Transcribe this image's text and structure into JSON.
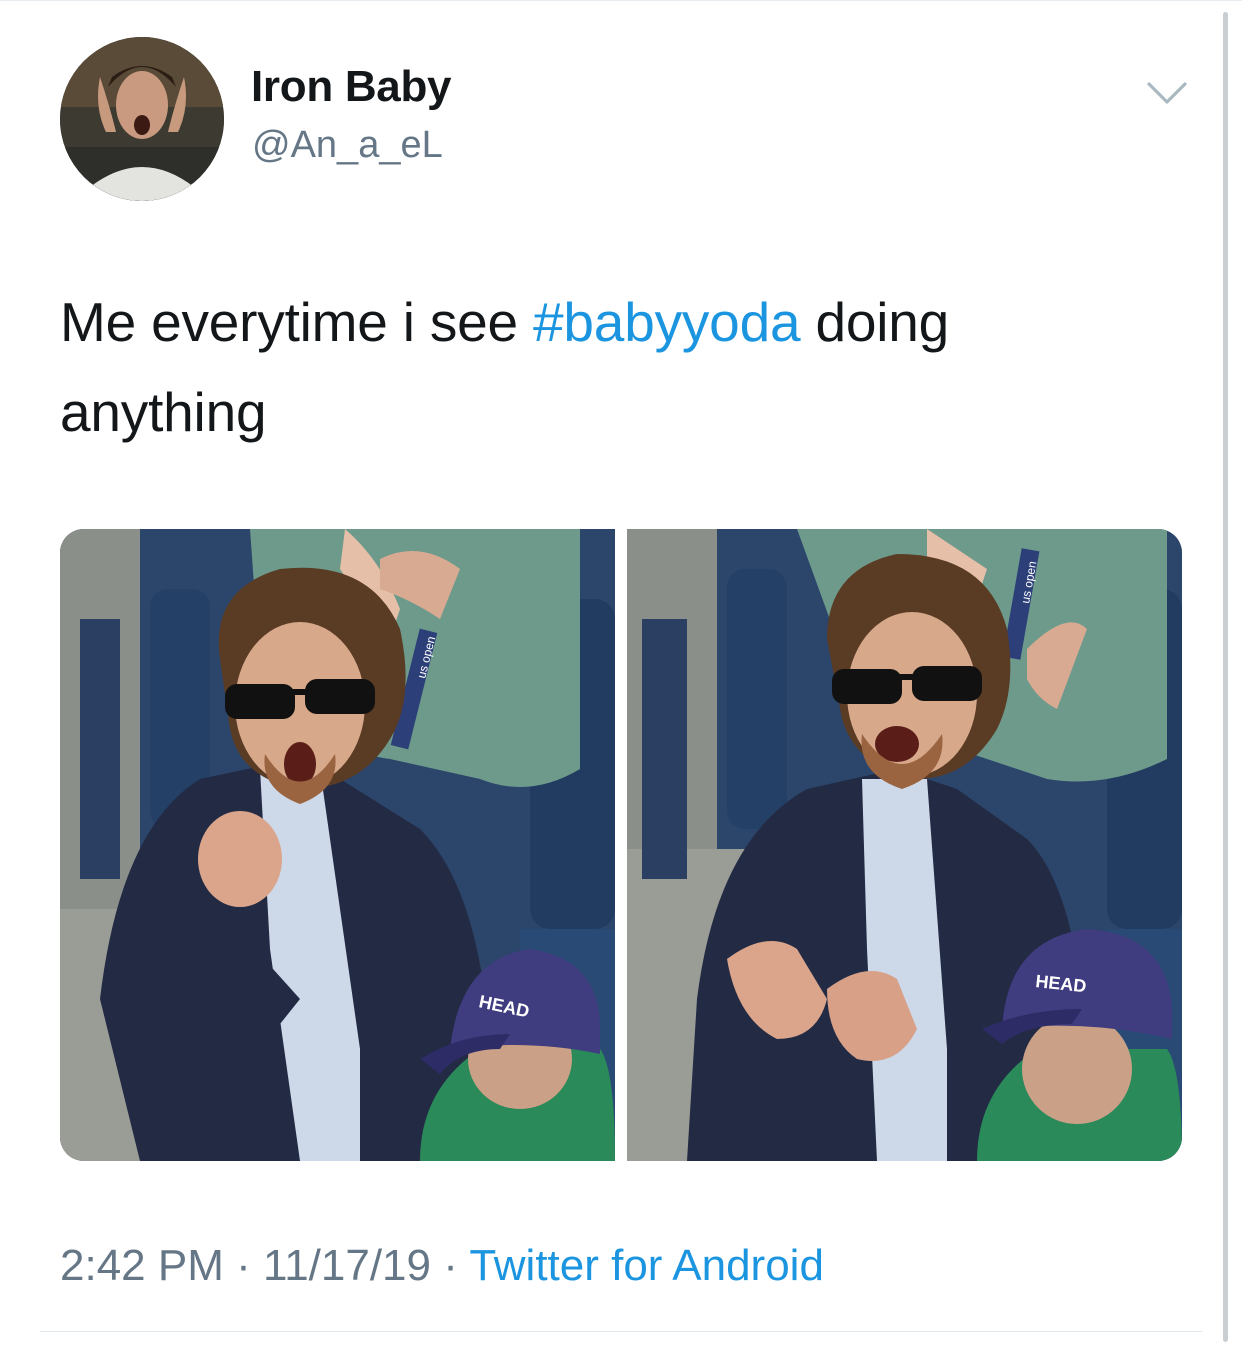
{
  "tweet": {
    "author": {
      "display_name": "Iron Baby",
      "handle": "@An_a_eL",
      "avatar_icon": "profile-photo"
    },
    "more_icon": "chevron-down-icon",
    "text": {
      "before": "Me everytime i see ",
      "hashtag": "#babyyoda",
      "after": " doing anything"
    },
    "media": {
      "count": 2,
      "photo_1": {
        "cap_text": "HEAD",
        "lanyard_text": "us open"
      },
      "photo_2": {
        "cap_text": "HEAD",
        "lanyard_text": "us open"
      }
    },
    "meta": {
      "time": "2:42 PM",
      "separator": " · ",
      "date": "11/17/19",
      "source": "Twitter for Android"
    }
  },
  "colors": {
    "text_primary": "#14171a",
    "text_secondary": "#657786",
    "link": "#1b95e0",
    "divider": "#e1e8ed"
  }
}
